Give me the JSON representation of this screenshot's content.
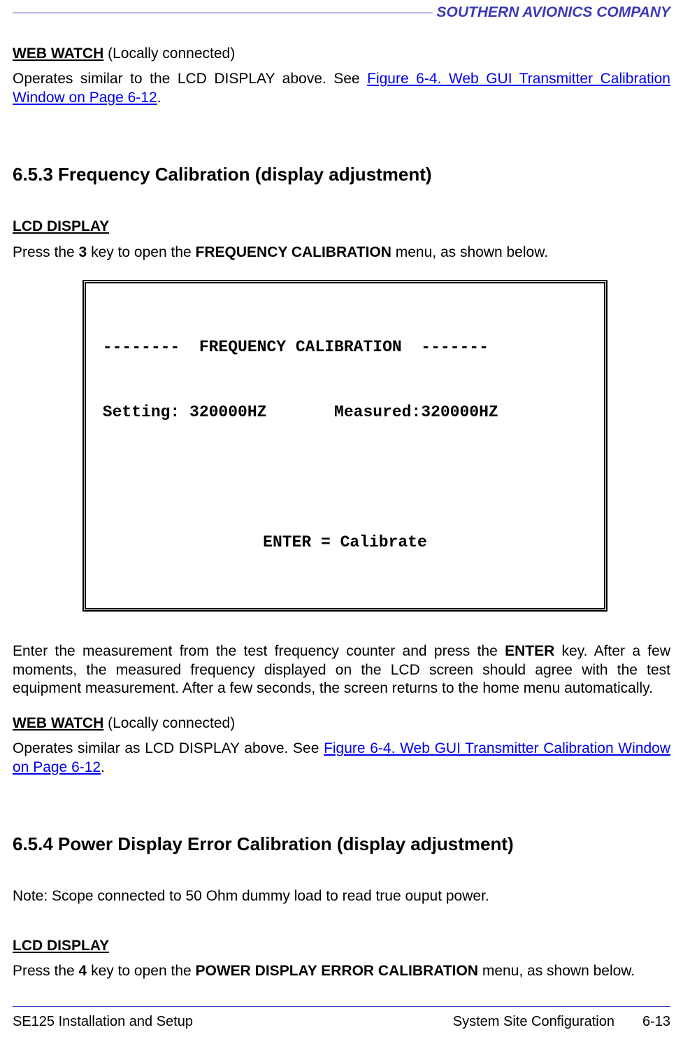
{
  "header": {
    "company": "SOUTHERN AVIONICS COMPANY"
  },
  "sections": {
    "webwatch1": {
      "title": "WEB WATCH",
      "locally": "  (Locally connected)",
      "body_pre": "Operates similar to the LCD DISPLAY above. See ",
      "link": "Figure 6-4.  Web GUI Transmitter Calibration Window on Page  6-12",
      "body_post": "."
    },
    "s653": {
      "number": "6.5.3  Frequency Calibration (display adjustment)",
      "lcd_title": "LCD DISPLAY",
      "lcd_intro_pre": "Press the ",
      "lcd_intro_key": "3",
      "lcd_intro_mid": " key to open the ",
      "lcd_intro_menu": "FREQUENCY CALIBRATION",
      "lcd_intro_post": " menu, as shown below.",
      "lcd_box": {
        "line1": " --------  FREQUENCY CALIBRATION  -------",
        "line2": " Setting: 320000HZ       Measured:320000HZ",
        "line3": "ENTER = Calibrate"
      },
      "after_box_pre": "Enter the measurement from the test frequency counter and press the ",
      "after_box_key": "ENTER",
      "after_box_post": " key.  After a few moments, the measured frequency displayed on the LCD screen should agree with the test equipment measurement. After a few seconds, the screen returns to the home menu automatically.",
      "webwatch2": {
        "title": "WEB WATCH",
        "locally": "  (Locally connected)",
        "body_pre": "Operates similar as LCD DISPLAY above.  See ",
        "link": "Figure 6-4.  Web GUI Transmitter Calibration Window on Page  6-12",
        "body_post": "."
      }
    },
    "s654": {
      "number": "6.5.4  Power Display Error Calibration (display adjustment)",
      "note": "Note:  Scope connected to 50 Ohm dummy load to read true ouput power.",
      "lcd_title": "LCD DISPLAY",
      "lcd_intro_pre": "Press the ",
      "lcd_intro_key": "4",
      "lcd_intro_mid": " key to open the ",
      "lcd_intro_menu": "POWER DISPLAY ERROR CALIBRATION",
      "lcd_intro_post": " menu, as shown below."
    }
  },
  "footer": {
    "left": "SE125 Installation and Setup",
    "center": "System Site Configuration",
    "right": "6-13"
  }
}
